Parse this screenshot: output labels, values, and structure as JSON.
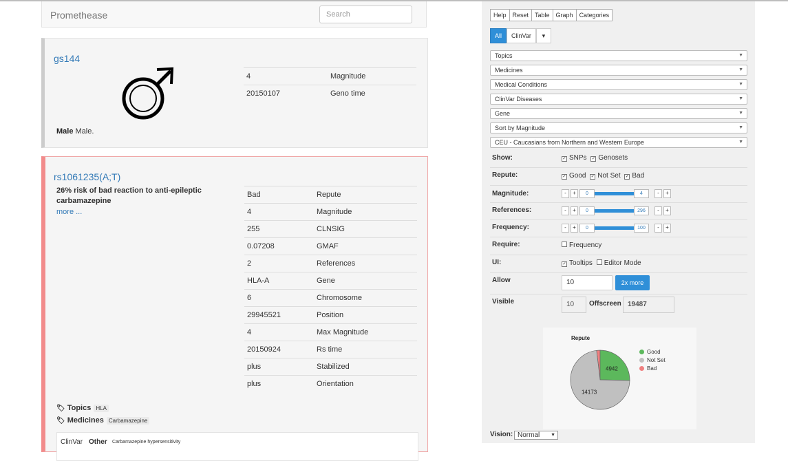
{
  "header": {
    "brand": "Promethease",
    "search_placeholder": "Search"
  },
  "card_gs144": {
    "title": "gs144",
    "summary_bold": "Male",
    "summary_text": "Male.",
    "rows": [
      {
        "value": "4",
        "label": "Magnitude"
      },
      {
        "value": "20150107",
        "label": "Geno time"
      }
    ]
  },
  "card_rs": {
    "title": "rs1061235(A;T)",
    "summary": "26% risk of bad reaction to anti-epileptic carbamazepine",
    "more": "more ...",
    "rows": [
      {
        "value": "Bad",
        "label": "Repute"
      },
      {
        "value": "4",
        "label": "Magnitude"
      },
      {
        "value": "255",
        "label": "CLNSIG"
      },
      {
        "value": "0.07208",
        "label": "GMAF"
      },
      {
        "value": "2",
        "label": "References"
      },
      {
        "value": "HLA-A",
        "label": "Gene"
      },
      {
        "value": "6",
        "label": "Chromosome"
      },
      {
        "value": "29945521",
        "label": "Position"
      },
      {
        "value": "4",
        "label": "Max Magnitude"
      },
      {
        "value": "20150924",
        "label": "Rs time"
      },
      {
        "value": "plus",
        "label": "Stabilized"
      },
      {
        "value": "plus",
        "label": "Orientation"
      }
    ],
    "topics_label": "Topics",
    "topics_chip": "HLA",
    "medicines_label": "Medicines",
    "medicines_chip": "Carbamazepine",
    "sub_a": "ClinVar",
    "sub_b": "Other",
    "sub_c": "Carbamazepine hypersensitivity"
  },
  "panel": {
    "buttons": [
      "Help",
      "Reset",
      "Table",
      "Graph",
      "Categories"
    ],
    "seg_all": "All",
    "seg_clinvar": "ClinVar",
    "selects": [
      "Topics",
      "Medicines",
      "Medical Conditions",
      "ClinVar Diseases",
      "Gene",
      "Sort by Magnitude",
      "CEU - Caucasians from Northern and Western Europe"
    ],
    "show_label": "Show:",
    "show_snps": "SNPs",
    "show_genosets": "Genosets",
    "repute_label": "Repute:",
    "repute_good": "Good",
    "repute_notset": "Not Set",
    "repute_bad": "Bad",
    "magnitude_label": "Magnitude:",
    "magnitude_min": "0",
    "magnitude_max": "4",
    "references_label": "References:",
    "references_min": "0",
    "references_max": "296",
    "frequency_label": "Frequency:",
    "frequency_min": "0",
    "frequency_max": "100",
    "require_label": "Require:",
    "require_frequency": "Frequency",
    "ui_label": "UI:",
    "ui_tooltips": "Tooltips",
    "ui_editor": "Editor Mode",
    "allow_label": "Allow",
    "allow_value": "10",
    "allow_button": "2x more",
    "visible_label": "Visible",
    "visible_value": "10",
    "offscreen_label": "Offscreen",
    "offscreen_value": "19487",
    "vision_label": "Vision:",
    "vision_value": "Normal",
    "plus": "+",
    "minus": "-"
  },
  "chart_data": {
    "type": "pie",
    "title": "Repute",
    "slices": [
      {
        "name": "Good",
        "value": 4942,
        "color": "#5cb85c"
      },
      {
        "name": "Not Set",
        "value": 14173,
        "color": "#c0c0c0"
      },
      {
        "name": "Bad",
        "value": 372,
        "color": "#f08080"
      }
    ],
    "legend_placement": "right"
  }
}
